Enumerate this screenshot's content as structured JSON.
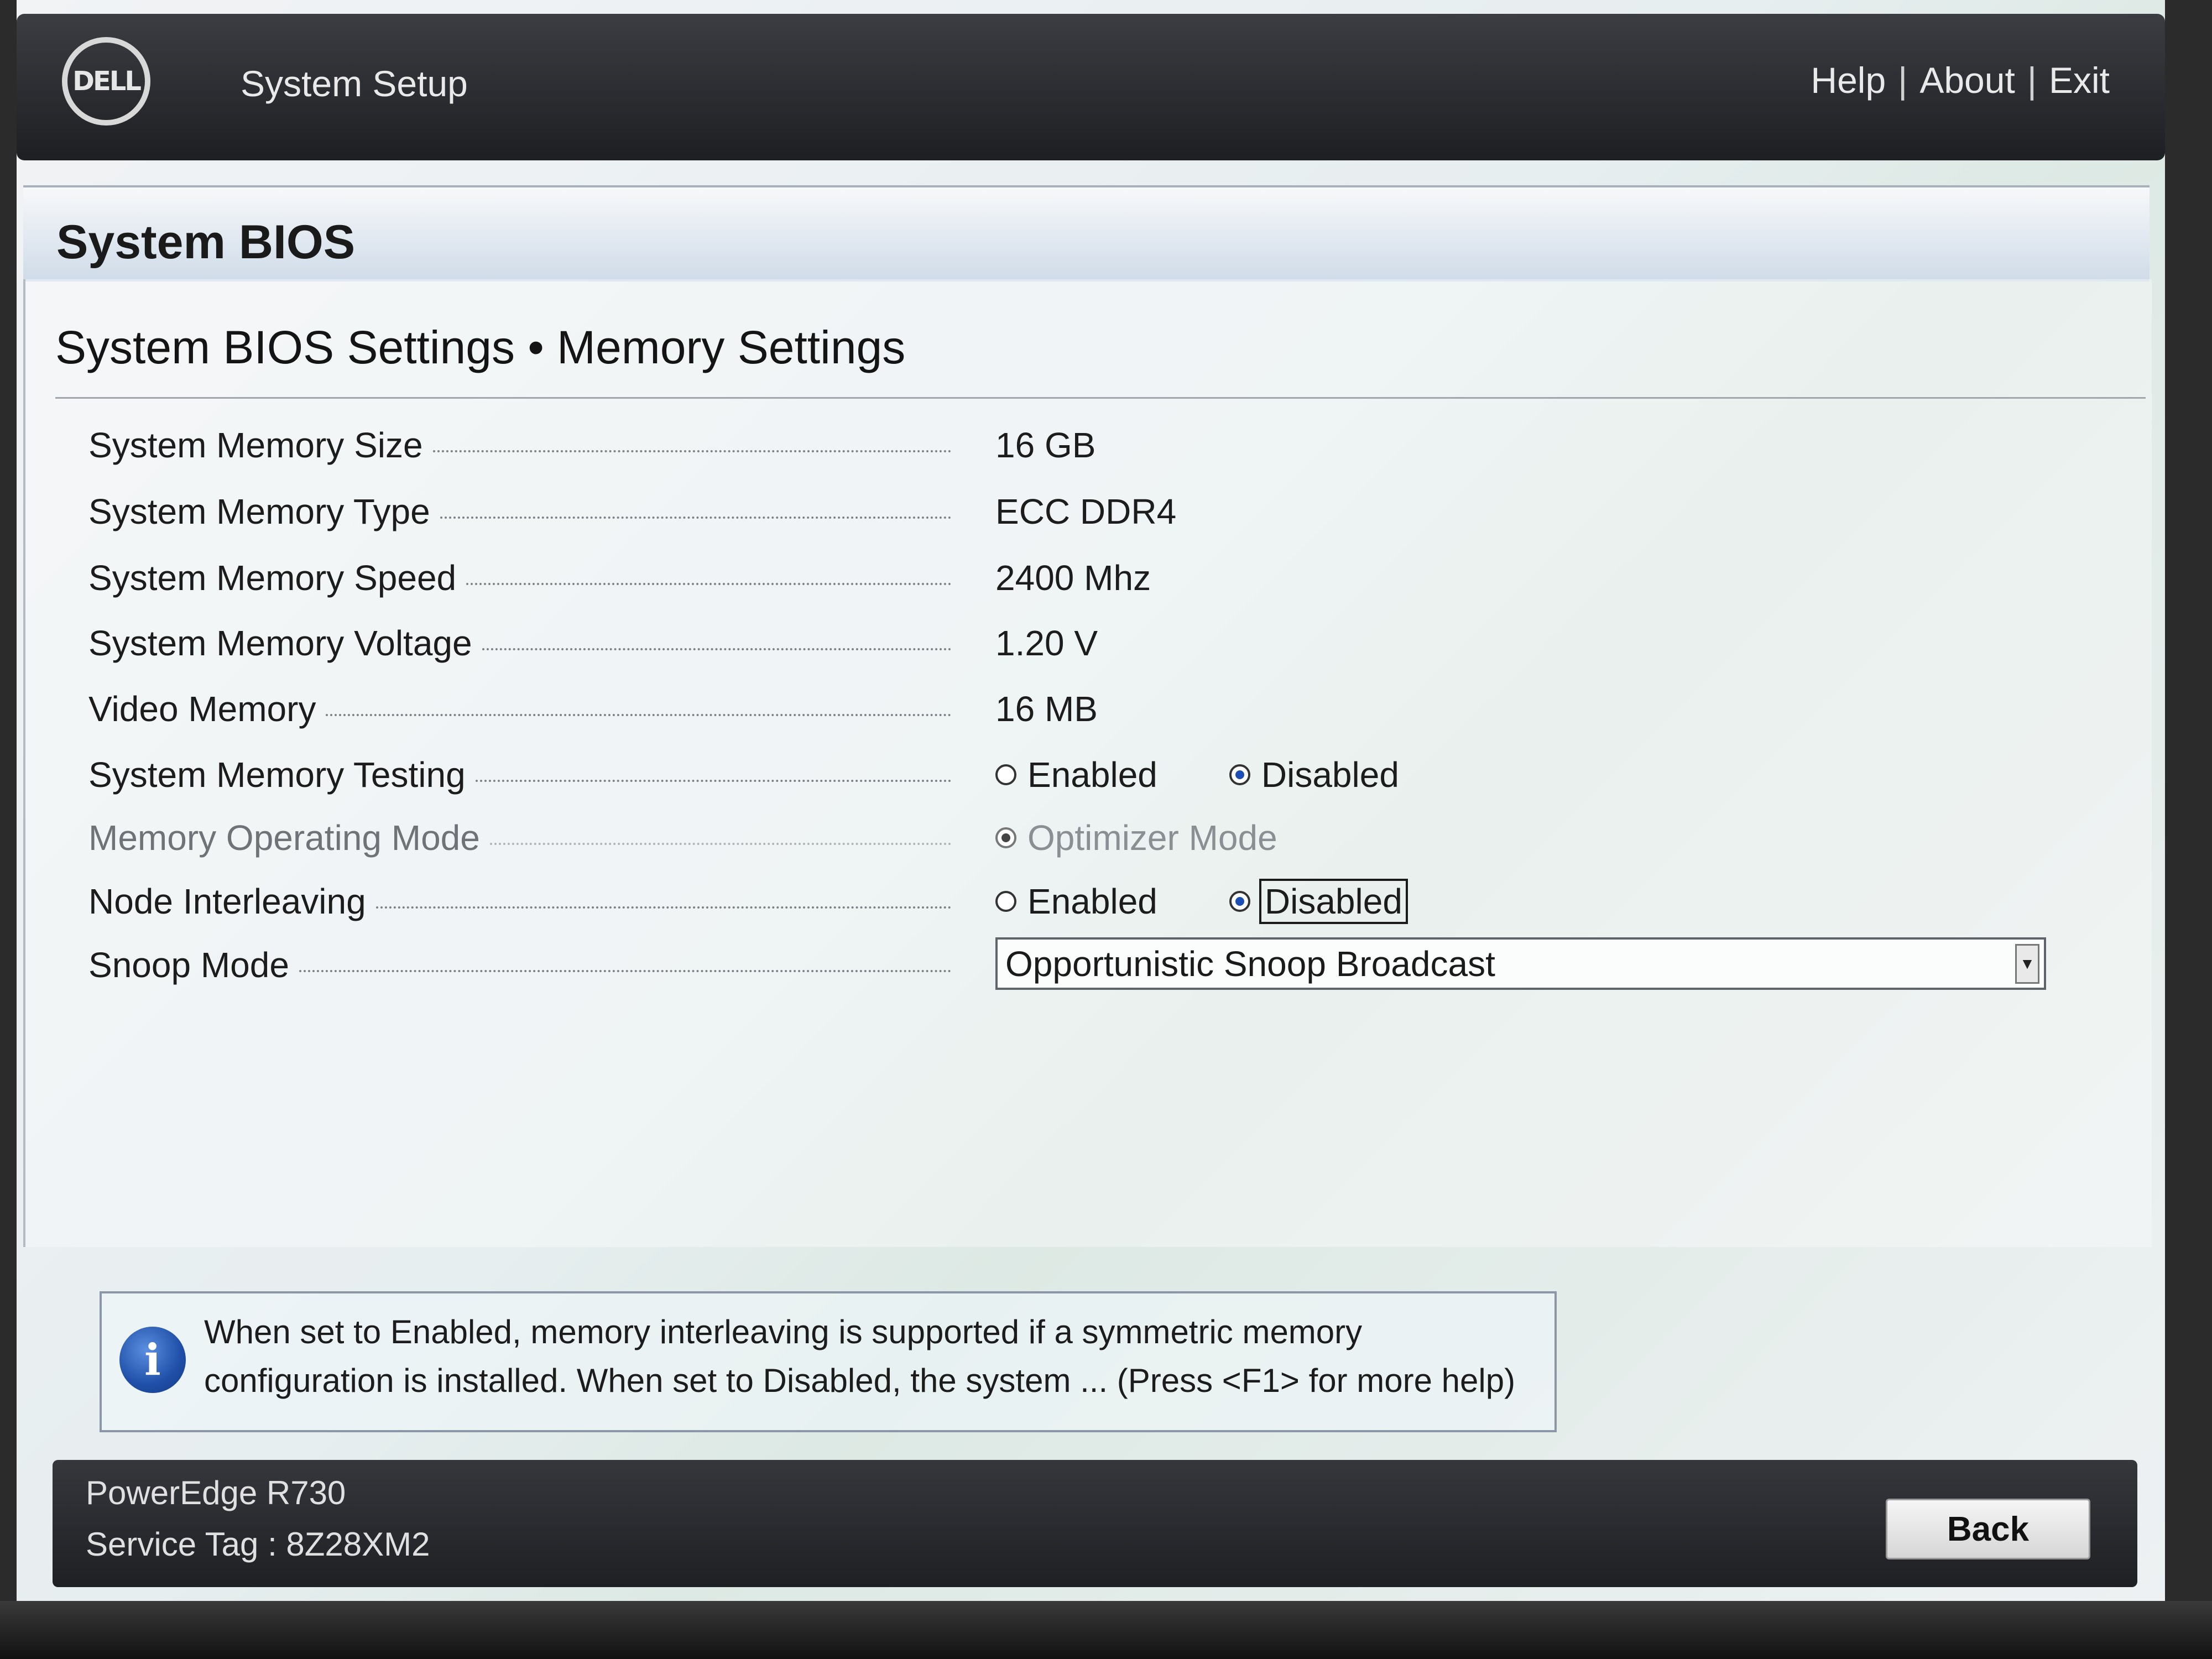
{
  "header": {
    "logo_text": "DELL",
    "app_title": "System Setup",
    "links": {
      "help": "Help",
      "about": "About",
      "exit": "Exit",
      "separator": "|"
    }
  },
  "page": {
    "title": "System BIOS",
    "section_title": "System BIOS Settings • Memory Settings"
  },
  "settings": [
    {
      "label": "System Memory Size",
      "value": "16 GB"
    },
    {
      "label": "System Memory Type",
      "value": "ECC DDR4"
    },
    {
      "label": "System Memory Speed",
      "value": "2400 Mhz"
    },
    {
      "label": "System Memory Voltage",
      "value": "1.20 V"
    },
    {
      "label": "Video Memory",
      "value": "16 MB"
    },
    {
      "label": "System Memory Testing",
      "options": [
        "Enabled",
        "Disabled"
      ],
      "selected": "Disabled"
    },
    {
      "label": "Memory Operating Mode",
      "options": [
        "Optimizer Mode"
      ],
      "selected": "Optimizer Mode",
      "disabled": true
    },
    {
      "label": "Node Interleaving",
      "options": [
        "Enabled",
        "Disabled"
      ],
      "selected": "Disabled",
      "focused": "Disabled"
    },
    {
      "label": "Snoop Mode",
      "select_value": "Opportunistic Snoop Broadcast"
    }
  ],
  "help": {
    "icon": "info-icon",
    "line1": "When set to Enabled, memory interleaving is supported if a symmetric memory",
    "line2": "configuration is installed. When set to Disabled, the system ... (Press <F1> for more help)"
  },
  "footer": {
    "model": "PowerEdge R730",
    "service_tag": "Service Tag : 8Z28XM2",
    "back_label": "Back"
  },
  "colors": {
    "header_bg": "#1d1f23",
    "radio_selected": "#1c4fb5",
    "info_icon": "#1f4fa8"
  }
}
